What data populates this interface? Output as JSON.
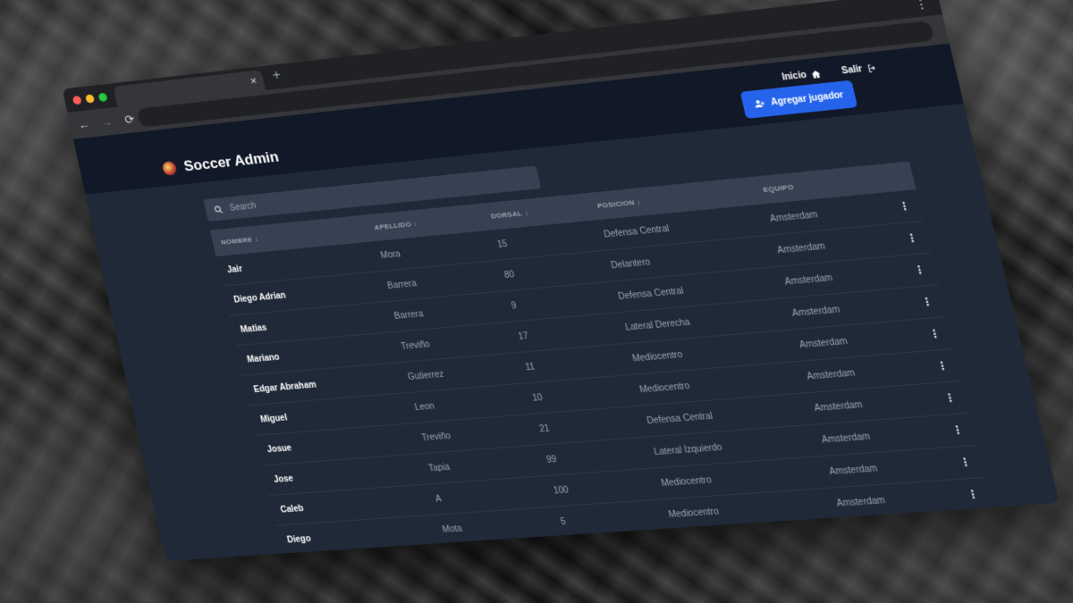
{
  "browser": {
    "tab_close": "×",
    "new_tab": "+",
    "menu": "⋮",
    "back": "←",
    "forward": "→",
    "reload": "⟳"
  },
  "header": {
    "inicio_label": "Inicio",
    "salir_label": "Salir"
  },
  "brand": {
    "title": "Soccer Admin"
  },
  "add_button": {
    "label": "Agregar jugador"
  },
  "search": {
    "placeholder": "Search"
  },
  "table": {
    "columns": [
      "NOMBRE ↓",
      "APELLIDO ↓",
      "DORSAL ↓",
      "POSICION ↓",
      "EQUIPO"
    ],
    "rows": [
      {
        "nombre": "Jair",
        "apellido": "Mora",
        "dorsal": "15",
        "posicion": "Defensa Central",
        "equipo": "Amsterdam"
      },
      {
        "nombre": "Diego Adrian",
        "apellido": "Barrera",
        "dorsal": "80",
        "posicion": "Delantero",
        "equipo": "Amsterdam"
      },
      {
        "nombre": "Matias",
        "apellido": "Barrera",
        "dorsal": "9",
        "posicion": "Defensa Central",
        "equipo": "Amsterdam"
      },
      {
        "nombre": "Mariano",
        "apellido": "Treviño",
        "dorsal": "17",
        "posicion": "Lateral Derecha",
        "equipo": "Amsterdam"
      },
      {
        "nombre": "Edgar Abraham",
        "apellido": "Gutierrez",
        "dorsal": "11",
        "posicion": "Mediocentro",
        "equipo": "Amsterdam"
      },
      {
        "nombre": "Miguel",
        "apellido": "Leon",
        "dorsal": "10",
        "posicion": "Mediocentro",
        "equipo": "Amsterdam"
      },
      {
        "nombre": "Josue",
        "apellido": "Treviño",
        "dorsal": "21",
        "posicion": "Defensa Central",
        "equipo": "Amsterdam"
      },
      {
        "nombre": "Jose",
        "apellido": "Tapia",
        "dorsal": "99",
        "posicion": "Lateral Izquierdo",
        "equipo": "Amsterdam"
      },
      {
        "nombre": "Caleb",
        "apellido": "A",
        "dorsal": "100",
        "posicion": "Mediocentro",
        "equipo": "Amsterdam"
      },
      {
        "nombre": "Diego",
        "apellido": "Mota",
        "dorsal": "5",
        "posicion": "Mediocentro",
        "equipo": "Amsterdam"
      }
    ],
    "row_menu": "⋮"
  }
}
